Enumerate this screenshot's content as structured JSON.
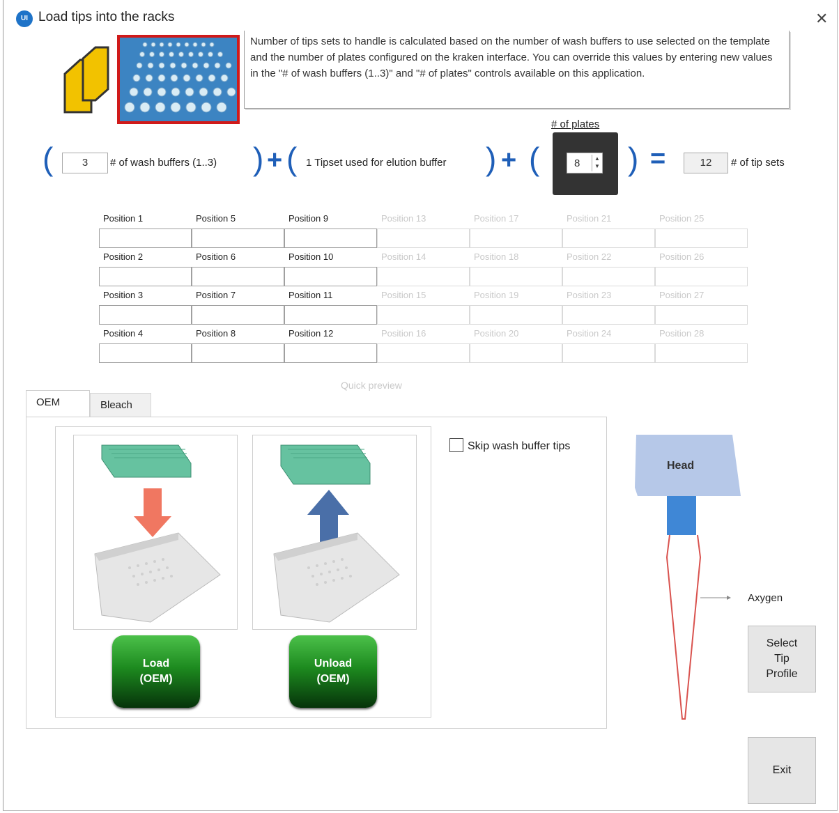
{
  "window": {
    "title": "Load tips into the racks",
    "icon_text": "UI"
  },
  "info": {
    "text": "Number of tips sets to handle is calculated based on the number of wash buffers to use selected on the template and the number of plates configured on the kraken interface. You can override this values by entering new values in the \"# of wash buffers (1..3)\" and \"# of plates\" controls available on this application."
  },
  "formula": {
    "wash_buffers_value": "3",
    "wash_buffers_label": "# of wash buffers (1..3)",
    "elution_text": "1 Tipset used for elution buffer",
    "plates_label": "# of plates",
    "plates_value": "8",
    "total_value": "12",
    "total_label": "# of tip sets"
  },
  "grid": {
    "columns": [
      [
        "Position 1",
        "Position 2",
        "Position 3",
        "Position 4"
      ],
      [
        "Position 5",
        "Position 6",
        "Position 7",
        "Position 8"
      ],
      [
        "Position 9",
        "Position 10",
        "Position 11",
        "Position 12"
      ],
      [
        "Position 13",
        "Position 14",
        "Position 15",
        "Position 16"
      ],
      [
        "Position 17",
        "Position 18",
        "Position 19",
        "Position 20"
      ],
      [
        "Position 21",
        "Position 22",
        "Position 23",
        "Position 24"
      ],
      [
        "Position 25",
        "Position 26",
        "Position 27",
        "Position 28"
      ]
    ],
    "active_columns": 3,
    "quick_preview": "Quick preview"
  },
  "tabs": [
    "OEM",
    "Bleach"
  ],
  "oem": {
    "load_button": "Load\n(OEM)",
    "unload_button": "Unload\n(OEM)",
    "skip_label": "Skip wash buffer tips",
    "skip_checked": false
  },
  "tip": {
    "head_label": "Head",
    "profile_label": "Axygen"
  },
  "buttons": {
    "select_tip_profile": "Select\nTip\nProfile",
    "exit": "Exit"
  },
  "colors": {
    "accent_blue": "#1f5fb8",
    "head_fill": "#b6c8e8",
    "tip_collar": "#3f87d6",
    "tip_outline": "#d9534f",
    "load_arrow": "#f07761",
    "unload_arrow": "#4a6fa8",
    "rack_teal": "#66c2a0"
  }
}
